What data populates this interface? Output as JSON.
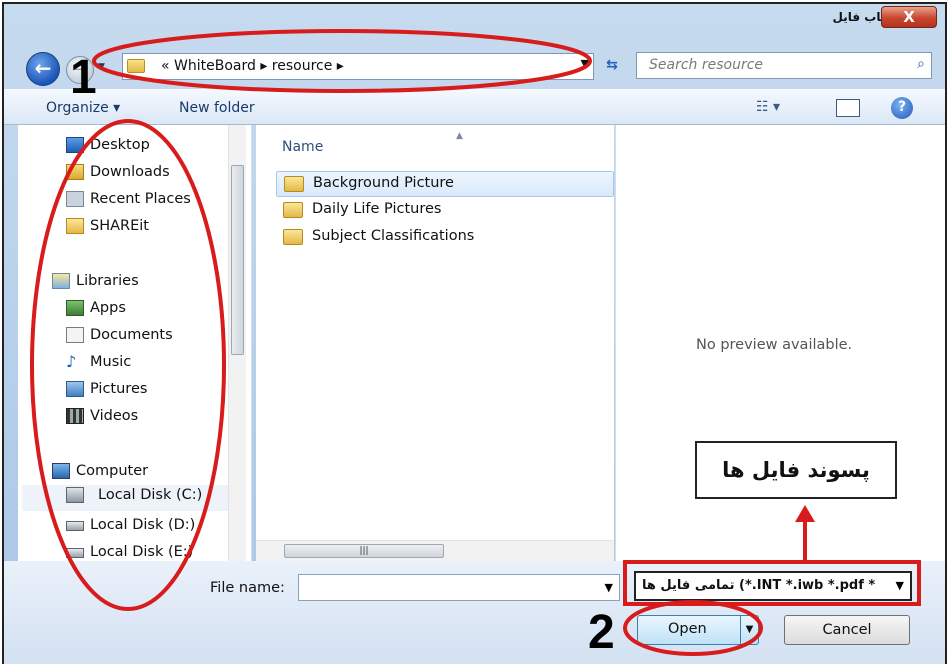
{
  "window": {
    "title": "انتخاب فایل",
    "close_label": "X"
  },
  "nav": {
    "back_icon": "back-arrow-icon",
    "forward_icon": "forward-arrow-icon"
  },
  "address": {
    "path": "« WhiteBoard ▸ resource ▸"
  },
  "search": {
    "placeholder": "Search resource"
  },
  "toolbar": {
    "organize": "Organize ▾",
    "new_folder": "New folder",
    "views": "☷ ▾",
    "help": "?"
  },
  "sidebar": {
    "items": [
      {
        "label": "Desktop",
        "icon": "desktop-icon"
      },
      {
        "label": "Downloads",
        "icon": "downloads-icon"
      },
      {
        "label": "Recent Places",
        "icon": "recent-places-icon"
      },
      {
        "label": "SHAREit",
        "icon": "folder-icon"
      },
      {
        "label": "Libraries",
        "icon": "libraries-icon"
      },
      {
        "label": "Apps",
        "icon": "apps-icon"
      },
      {
        "label": "Documents",
        "icon": "documents-icon"
      },
      {
        "label": "Music",
        "icon": "music-icon"
      },
      {
        "label": "Pictures",
        "icon": "pictures-icon"
      },
      {
        "label": "Videos",
        "icon": "videos-icon"
      },
      {
        "label": "Computer",
        "icon": "computer-icon"
      },
      {
        "label": "Local Disk (C:)",
        "icon": "drive-icon"
      },
      {
        "label": "Local Disk (D:)",
        "icon": "drive-icon"
      },
      {
        "label": "Local Disk (E:)",
        "icon": "drive-icon"
      }
    ]
  },
  "files": {
    "column_name": "Name",
    "items": [
      {
        "label": "Background Picture",
        "selected": true
      },
      {
        "label": "Daily Life Pictures",
        "selected": false
      },
      {
        "label": "Subject Classifications",
        "selected": false
      }
    ]
  },
  "preview": {
    "message": "No preview available."
  },
  "bottom": {
    "file_name_label": "File name:",
    "file_name_value": "",
    "filter_label": "تمامی فایل ها (*.INT *.iwb *.pdf *",
    "open_label": "Open",
    "cancel_label": "Cancel"
  },
  "annotations": {
    "label1": "1",
    "label2": "2",
    "callout_text": "پسوند فایل ها",
    "highlight_color": "#d81b1b"
  }
}
